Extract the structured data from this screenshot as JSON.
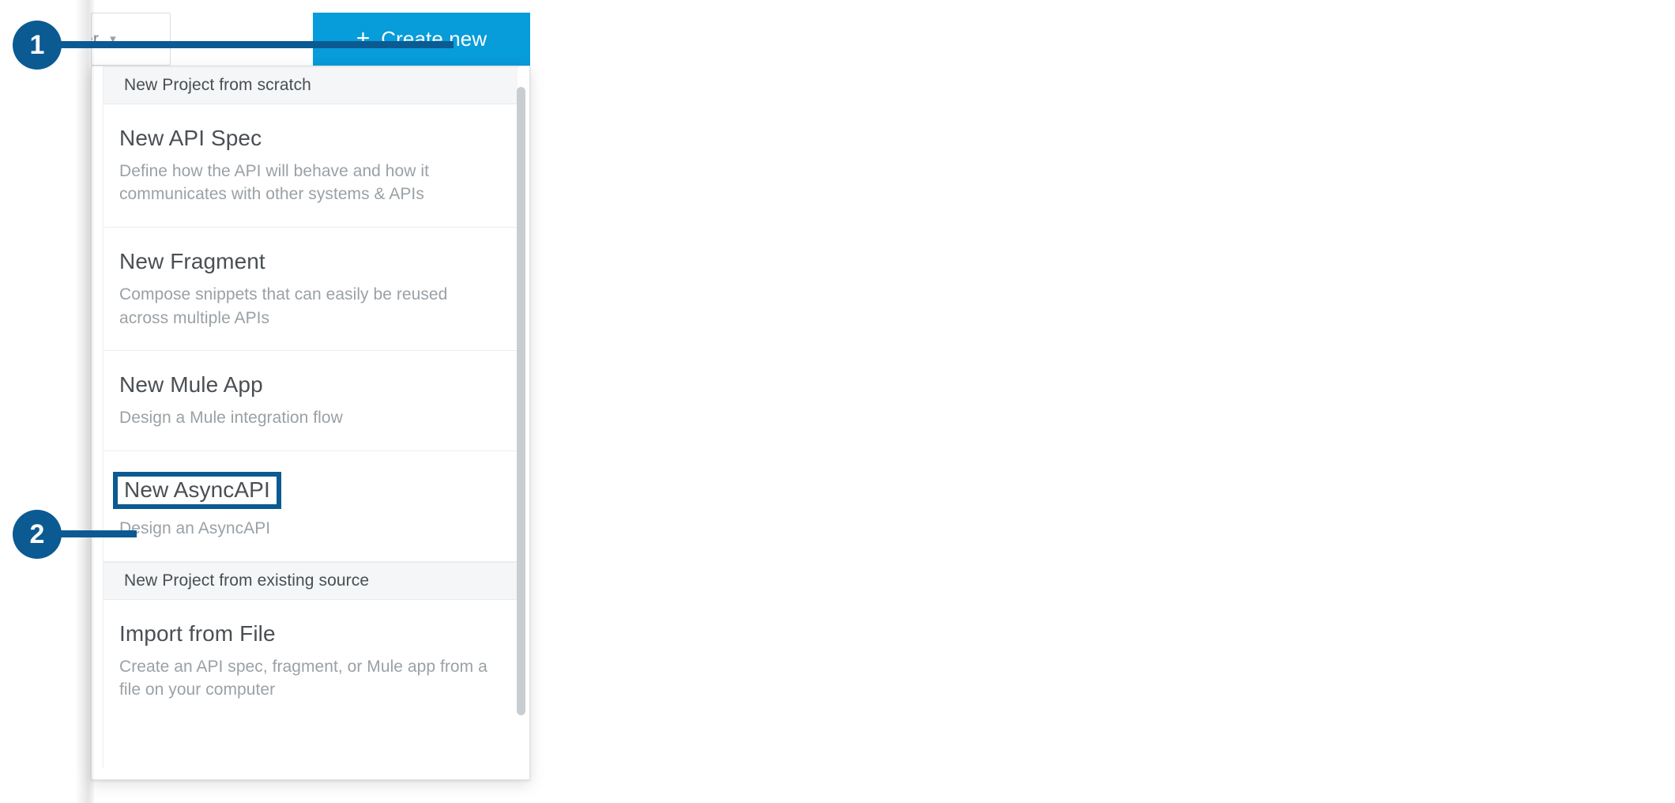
{
  "toolbar": {
    "project_select": {
      "value": "er",
      "caret_icon": "chevron-down-icon"
    },
    "create_button": {
      "label": "Create new",
      "plus_icon": "+",
      "color": "#079cda"
    }
  },
  "dropdown": {
    "sections": [
      {
        "header": "New Project from scratch",
        "items": [
          {
            "title": "New API Spec",
            "description": "Define how the API will behave and how it communicates with other systems & APIs",
            "highlighted": false
          },
          {
            "title": "New Fragment",
            "description": "Compose snippets that can easily be reused across multiple APIs",
            "highlighted": false
          },
          {
            "title": "New Mule App",
            "description": "Design a Mule integration flow",
            "highlighted": false
          },
          {
            "title": "New AsyncAPI",
            "description": "Design an AsyncAPI",
            "highlighted": true
          }
        ]
      },
      {
        "header": "New Project from existing source",
        "items": [
          {
            "title": "Import from File",
            "description": "Create an API spec, fragment, or Mule app from a file on your computer",
            "highlighted": false
          }
        ]
      }
    ]
  },
  "callouts": [
    {
      "number": "1",
      "color": "#0b5a92",
      "target": "create-new-button"
    },
    {
      "number": "2",
      "color": "#0b5a92",
      "target": "new-asyncapi-item"
    }
  ]
}
